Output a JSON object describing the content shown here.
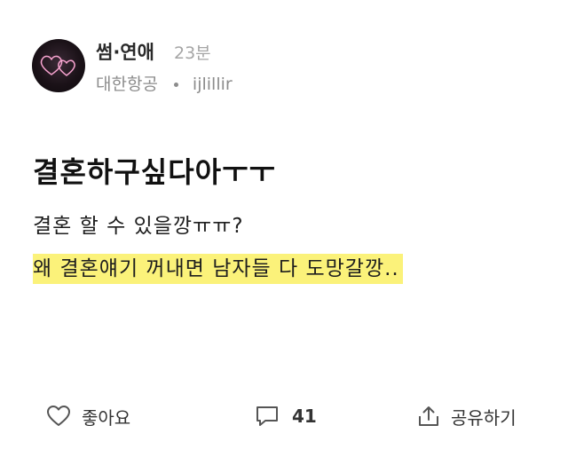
{
  "post": {
    "category": "썸·연애",
    "time_ago": "23분",
    "company": "대한항공",
    "author": "ijlillir",
    "title": "결혼하구싶다아ㅜㅜ",
    "body_line1": "결혼 할 수 있을깡ㅠㅠ?",
    "body_line2": "왜 결혼얘기 꺼내면 남자들 다 도망갈깡.."
  },
  "actions": {
    "like_label": "좋아요",
    "comment_count": "41",
    "share_label": "공유하기"
  },
  "icons": {
    "avatar": "neon-hearts-icon",
    "like": "heart-outline-icon",
    "comment": "speech-bubble-icon",
    "share": "share-upload-icon"
  },
  "colors": {
    "highlight": "#fbf27a",
    "avatar_heart": "#e27fb0"
  }
}
